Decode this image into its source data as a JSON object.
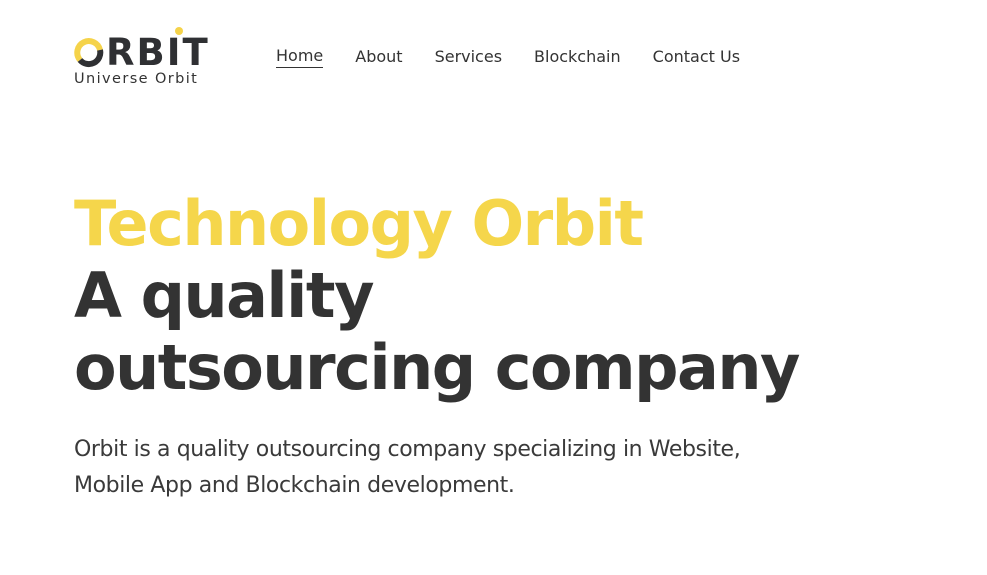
{
  "brand": {
    "name": "ORBIT",
    "tagline": "Universe Orbit",
    "colors": {
      "accent": "#f5d64b",
      "text": "#333333",
      "background": "#ffffff"
    }
  },
  "nav": {
    "items": [
      {
        "label": "Home",
        "active": true
      },
      {
        "label": "About",
        "active": false
      },
      {
        "label": "Services",
        "active": false
      },
      {
        "label": "Blockchain",
        "active": false
      },
      {
        "label": "Contact Us",
        "active": false
      }
    ]
  },
  "hero": {
    "accent_title": "Technology Orbit",
    "title_line_1": "A quality",
    "title_line_2": "outsourcing company",
    "description": "Orbit is a quality outsourcing company specializing in Website, Mobile App and Blockchain development."
  }
}
